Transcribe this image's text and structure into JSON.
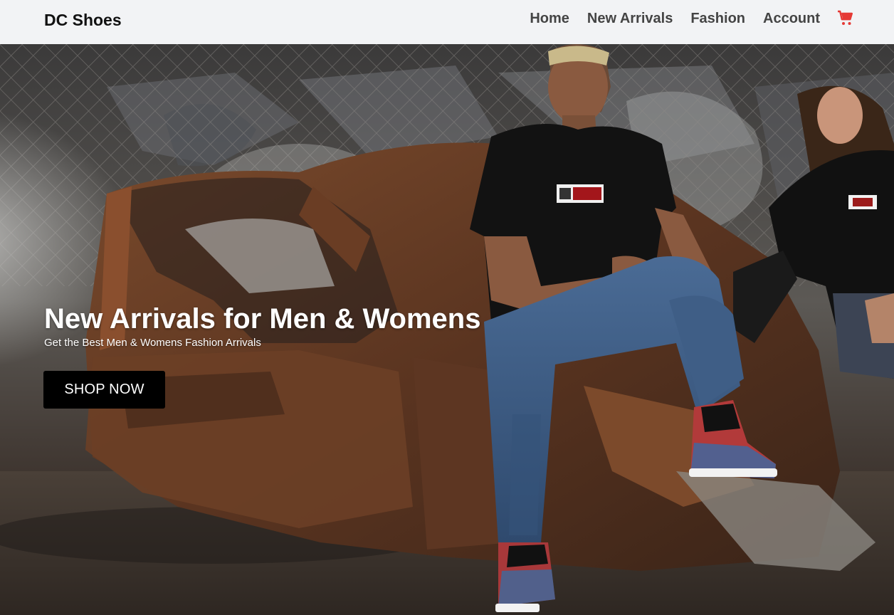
{
  "nav": {
    "brand": "DC Shoes",
    "links": [
      "Home",
      "New Arrivals",
      "Fashion",
      "Account"
    ],
    "cart_icon": "shopping-cart-icon",
    "cart_color": "#e53935"
  },
  "hero": {
    "title": "New Arrivals for Men & Womens",
    "subtitle": "Get the Best Men & Womens Fashion Arrivals",
    "cta_label": "SHOP NOW"
  }
}
